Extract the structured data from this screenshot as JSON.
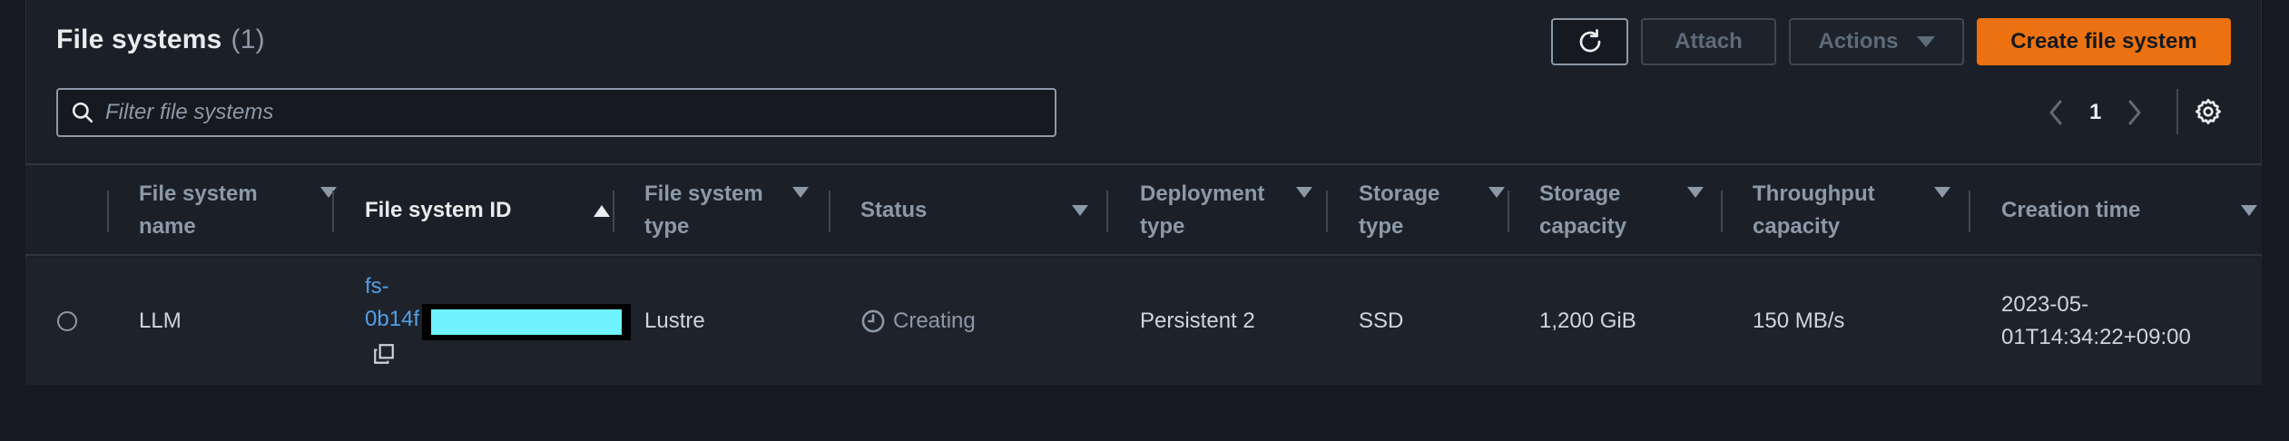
{
  "header": {
    "title": "File systems",
    "count": "(1)"
  },
  "toolbar": {
    "refresh_icon": "refresh-icon",
    "attach_label": "Attach",
    "actions_label": "Actions",
    "create_label": "Create file system"
  },
  "search": {
    "placeholder": "Filter file systems",
    "value": ""
  },
  "pagination": {
    "current_page": "1"
  },
  "colors": {
    "primary_button": "#ec7211",
    "link": "#539fe5",
    "redaction": "#6ef3ff"
  },
  "table": {
    "columns": [
      {
        "key": "name",
        "label": "File system name"
      },
      {
        "key": "id",
        "label": "File system ID",
        "sorted": "ascending"
      },
      {
        "key": "type",
        "label": "File system type"
      },
      {
        "key": "status",
        "label": "Status"
      },
      {
        "key": "deployment",
        "label": "Deployment type"
      },
      {
        "key": "storage_type",
        "label": "Storage type"
      },
      {
        "key": "storage_capacity",
        "label": "Storage capacity"
      },
      {
        "key": "throughput",
        "label": "Throughput capacity"
      },
      {
        "key": "creation_time",
        "label": "Creation time"
      }
    ],
    "rows": [
      {
        "name": "LLM",
        "id_line1": "fs-",
        "id_line2": "0b14f",
        "type": "Lustre",
        "status": "Creating",
        "deployment": "Persistent 2",
        "storage_type": "SSD",
        "storage_capacity": "1,200 GiB",
        "throughput": "150 MB/s",
        "creation_time_line1": "2023-05-",
        "creation_time_line2": "01T14:34:22+09:00"
      }
    ]
  }
}
